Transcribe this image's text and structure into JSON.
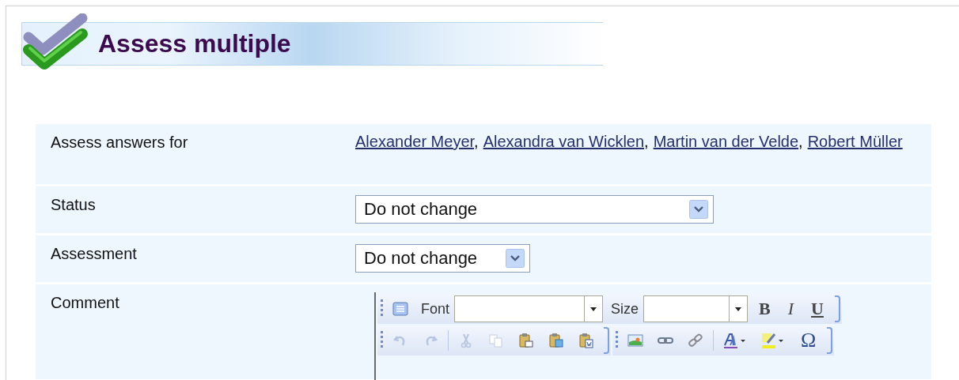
{
  "header": {
    "title": "Assess multiple"
  },
  "form": {
    "rows": [
      {
        "kind": "links",
        "label": "Assess answers for",
        "separator": ",",
        "links": [
          "Alexander Meyer",
          "Alexandra van Wicklen",
          "Martin van der Velde",
          "Robert Müller"
        ]
      },
      {
        "kind": "select",
        "label": "Status",
        "value": "Do not change",
        "wide": true
      },
      {
        "kind": "select",
        "label": "Assessment",
        "value": "Do not change",
        "wide": false
      },
      {
        "kind": "editor",
        "label": "Comment",
        "toolbar": {
          "font_label": "Font",
          "size_label": "Size",
          "bold": "B",
          "italic": "I",
          "underline": "U",
          "special_char": "Ω"
        }
      }
    ]
  }
}
